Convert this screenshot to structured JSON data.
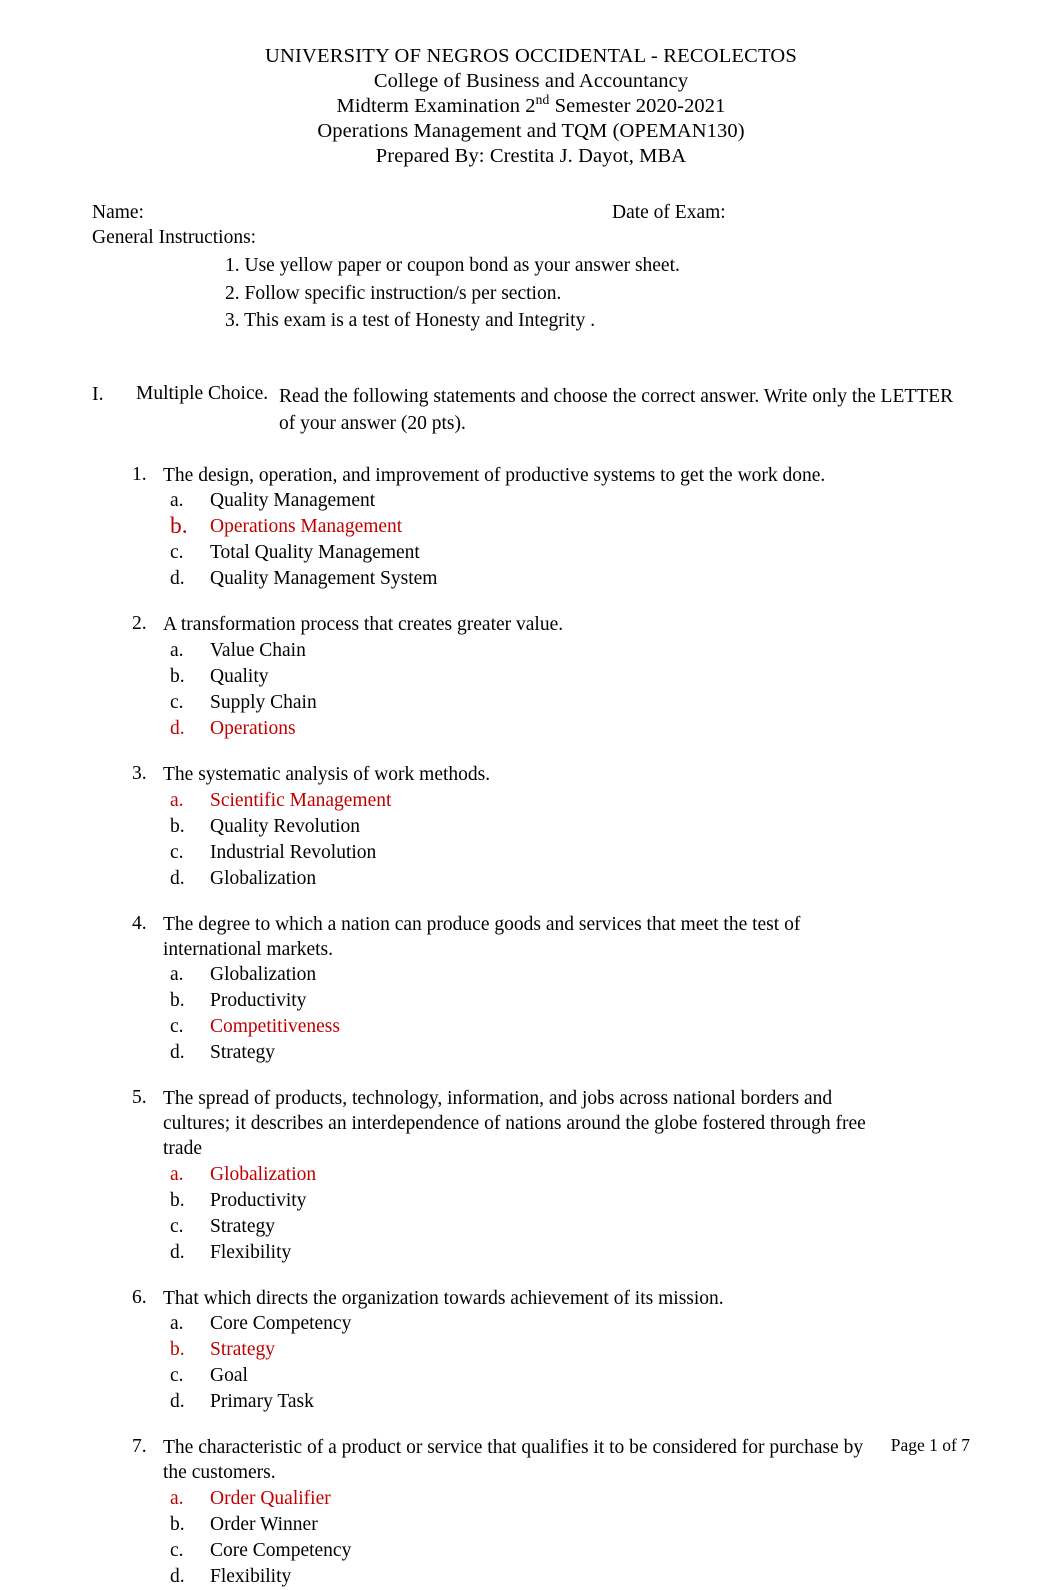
{
  "header": {
    "line1": "UNIVERSITY OF NEGROS OCCIDENTAL - RECOLECTOS",
    "line2": "College of Business and Accountancy",
    "line3_prefix": "Midterm Examination 2",
    "line3_sup": "nd",
    "line3_suffix": " Semester 2020-2021",
    "line4": "Operations Management and TQM (OPEMAN130)",
    "line5": "Prepared By: Crestita J. Dayot, MBA"
  },
  "fields": {
    "name_label": "Name:",
    "date_label": "Date of Exam:",
    "general_instructions_label": "General Instructions:",
    "instructions": [
      "1. Use yellow paper or coupon bond as your answer sheet.",
      "2. Follow specific instruction/s per section.",
      "3. This exam is a test of Honesty and Integrity ."
    ]
  },
  "section": {
    "numeral": "I.",
    "title": "Multiple Choice.",
    "description": "Read the following statements and choose the correct answer. Write only the LETTER of your answer (20 pts)."
  },
  "answer_color": "#C00000",
  "questions": [
    {
      "number": "1.",
      "stem": "The design, operation, and improvement of productive systems to get the work done.",
      "choices": [
        {
          "letter": "a.",
          "text": "Quality Management",
          "answer": false
        },
        {
          "letter": "b.",
          "text": "Operations Management",
          "answer": true,
          "big_letter": true
        },
        {
          "letter": "c.",
          "text": "Total Quality Management",
          "answer": false
        },
        {
          "letter": "d.",
          "text": "Quality Management System",
          "answer": false
        }
      ]
    },
    {
      "number": "2.",
      "stem": "A transformation process that creates greater value.",
      "choices": [
        {
          "letter": "a.",
          "text": "Value Chain",
          "answer": false
        },
        {
          "letter": "b.",
          "text": "Quality",
          "answer": false
        },
        {
          "letter": "c.",
          "text": "Supply Chain",
          "answer": false
        },
        {
          "letter": "d.",
          "text": "Operations",
          "answer": true
        }
      ]
    },
    {
      "number": "3.",
      "stem": "The systematic analysis of work methods.",
      "choices": [
        {
          "letter": "a.",
          "text": "Scientific Management",
          "answer": true
        },
        {
          "letter": "b.",
          "text": "Quality Revolution",
          "answer": false
        },
        {
          "letter": "c.",
          "text": "Industrial Revolution",
          "answer": false
        },
        {
          "letter": "d.",
          "text": "Globalization",
          "answer": false
        }
      ]
    },
    {
      "number": "4.",
      "stem": "The degree to which a nation can produce goods and services that meet the test of international markets.",
      "choices": [
        {
          "letter": "a.",
          "text": "Globalization",
          "answer": false
        },
        {
          "letter": "b.",
          "text": "Productivity",
          "answer": false
        },
        {
          "letter": "c.",
          "text": "Competitiveness",
          "answer": true,
          "letter_black": true
        },
        {
          "letter": "d.",
          "text": "Strategy",
          "answer": false
        }
      ]
    },
    {
      "number": "5.",
      "stem": "The spread of products, technology, information, and jobs across national borders and cultures; it describes an interdependence of nations around the globe fostered through free trade",
      "choices": [
        {
          "letter": "a.",
          "text": "Globalization",
          "answer": true
        },
        {
          "letter": "b.",
          "text": "Productivity",
          "answer": false
        },
        {
          "letter": "c.",
          "text": "Strategy",
          "answer": false
        },
        {
          "letter": "d.",
          "text": "Flexibility",
          "answer": false
        }
      ]
    },
    {
      "number": "6.",
      "stem": "That which directs the organization towards achievement of its mission.",
      "choices": [
        {
          "letter": "a.",
          "text": "Core Competency",
          "answer": false
        },
        {
          "letter": "b.",
          "text": "Strategy",
          "answer": true
        },
        {
          "letter": "c.",
          "text": "Goal",
          "answer": false
        },
        {
          "letter": "d.",
          "text": "Primary Task",
          "answer": false
        }
      ]
    },
    {
      "number": "7.",
      "stem": "The characteristic of a product or service that qualifies it to be considered for purchase by the customers.",
      "choices": [
        {
          "letter": "a.",
          "text": "Order Qualifier",
          "answer": true
        },
        {
          "letter": "b.",
          "text": "Order Winner",
          "answer": false
        },
        {
          "letter": "c.",
          "text": "Core Competency",
          "answer": false
        },
        {
          "letter": "d.",
          "text": "Flexibility",
          "answer": false
        }
      ]
    }
  ],
  "footer": {
    "page_label": "Page 1 of 7"
  }
}
